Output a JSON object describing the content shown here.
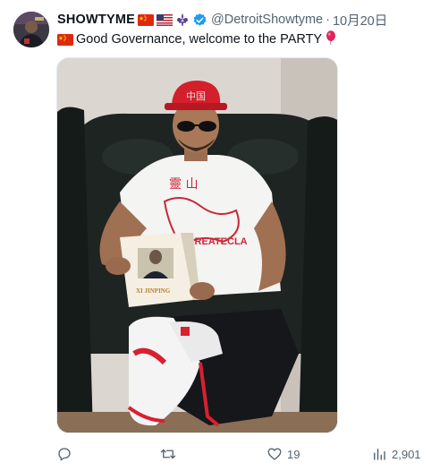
{
  "tweet": {
    "display_name": "SHOWTYME",
    "handle": "@DetroitShowtyme",
    "separator": "·",
    "date": "10月20日",
    "text": "Good Governance, welcome to the PARTY",
    "flags": [
      "china-flag",
      "usa-flag",
      "fleur-de-lis"
    ],
    "verified": true
  },
  "media": {
    "book_title": "XI JINPING",
    "shirt_text": "GREATECLA",
    "cap_text": "中国"
  },
  "actions": {
    "replies": "",
    "retweets": "",
    "likes": "19",
    "views": "2,901"
  },
  "colors": {
    "accent_blue": "#1d9bf0",
    "secondary_text": "#536471",
    "china_red": "#de2910",
    "star_yellow": "#ffde00"
  }
}
